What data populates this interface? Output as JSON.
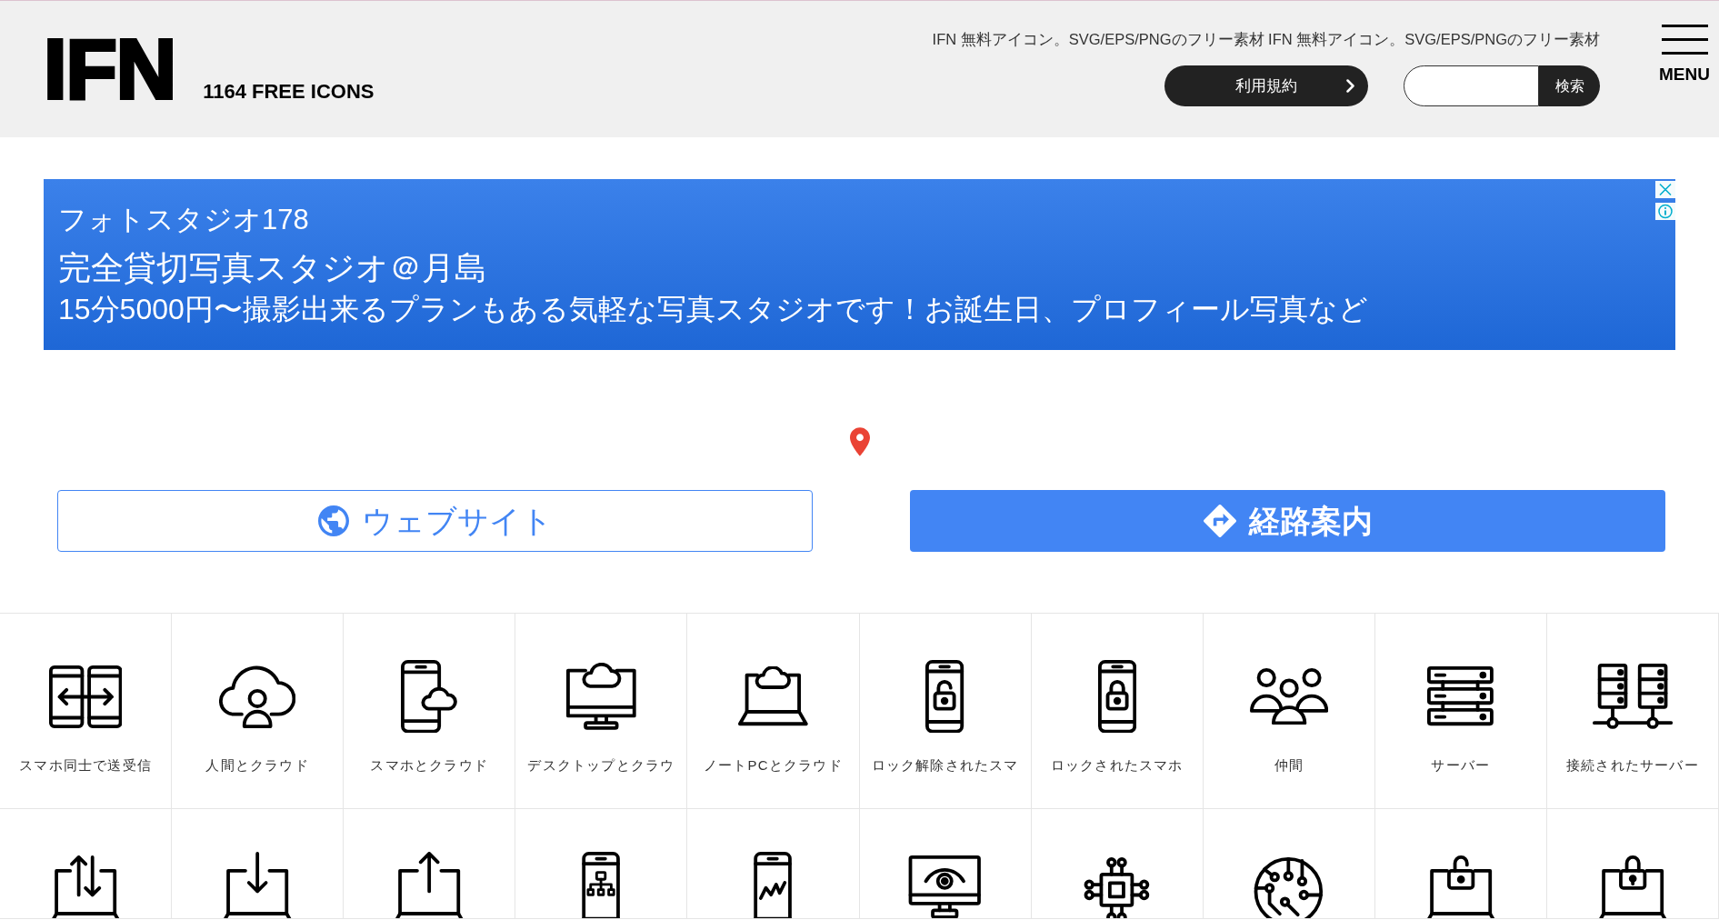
{
  "header": {
    "logo": "IFN",
    "tagline": "1164 FREE ICONS",
    "notice": "IFN 無料アイコン。SVG/EPS/PNGのフリー素材 IFN 無料アイコン。SVG/EPS/PNGのフリー素材",
    "terms_button": "利用規約",
    "search": {
      "button": "検索"
    },
    "menu": {
      "label": "MENU"
    }
  },
  "ad": {
    "advertiser": "フォトスタジオ178",
    "headline": "完全貸切写真スタジオ＠月島",
    "description": "15分5000円〜撮影出来るプランもある気軽な写真スタジオです！お誕生日、プロフィール写真など"
  },
  "actions": [
    {
      "kind": "website",
      "label": "ウェブサイト"
    },
    {
      "kind": "directions",
      "label": "経路案内"
    }
  ],
  "icon_grid": [
    {
      "kind": "phones-exchange",
      "label": "スマホ同士で送受信"
    },
    {
      "kind": "cloud-person",
      "label": "人間とクラウド"
    },
    {
      "kind": "phone-cloud",
      "label": "スマホとクラウド"
    },
    {
      "kind": "desktop-cloud",
      "label": "デスクトップとクラウ"
    },
    {
      "kind": "laptop-cloud",
      "label": "ノートPCとクラウド"
    },
    {
      "kind": "phone-unlocked",
      "label": "ロック解除されたスマ"
    },
    {
      "kind": "phone-locked",
      "label": "ロックされたスマホ"
    },
    {
      "kind": "people",
      "label": "仲間"
    },
    {
      "kind": "server",
      "label": "サーバー"
    },
    {
      "kind": "servers-network",
      "label": "接続されたサーバー"
    },
    {
      "kind": "laptop-arrows"
    },
    {
      "kind": "laptop-download"
    },
    {
      "kind": "laptop-upload"
    },
    {
      "kind": "phone-sitemap"
    },
    {
      "kind": "phone-chart"
    },
    {
      "kind": "monitor-eye"
    },
    {
      "kind": "chip"
    },
    {
      "kind": "circuit-globe"
    },
    {
      "kind": "laptop-unlocked"
    },
    {
      "kind": "laptop-locked"
    }
  ]
}
